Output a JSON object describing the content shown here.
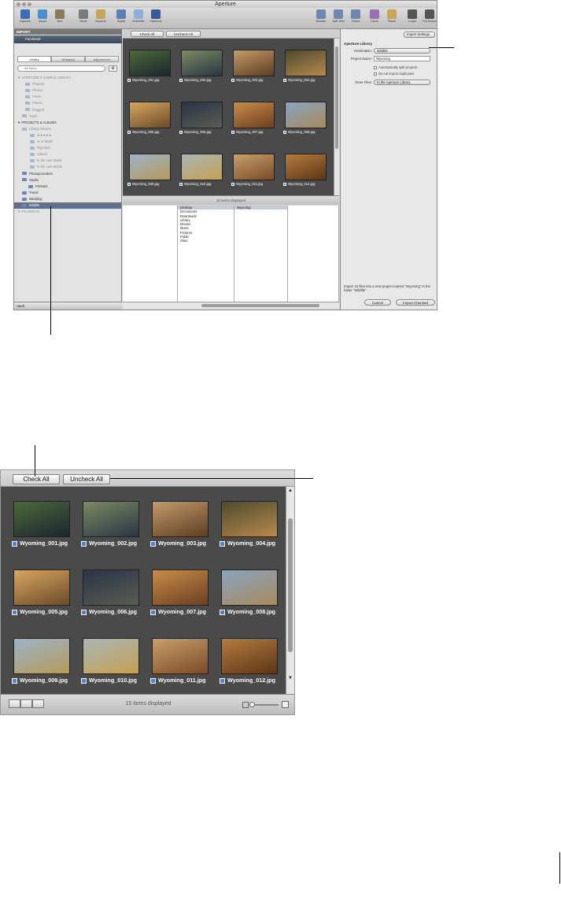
{
  "window": {
    "title": "Aperture",
    "toolbar": [
      "Inspector",
      "Import",
      "New",
      "Name",
      "Keyword",
      "Rotate",
      "MobileMe",
      "Facebook",
      "Browser",
      "Split View",
      "Viewer",
      "Faces",
      "Places",
      "Loupe",
      "Full Screen"
    ],
    "inspector_header": "IMPORT",
    "device": "Facebook"
  },
  "sidebar": {
    "tabs": [
      "Library",
      "Metadata",
      "Adjustments"
    ],
    "search_placeholder": "All Items",
    "tree": [
      {
        "label": "APERTURE 3 SAMPLE LIBRARY",
        "kind": "header",
        "dim": true
      },
      {
        "label": "Projects",
        "kind": "item",
        "dim": true
      },
      {
        "label": "Photos",
        "kind": "item",
        "dim": true
      },
      {
        "label": "Faces",
        "kind": "item",
        "dim": true
      },
      {
        "label": "Places",
        "kind": "item",
        "dim": true
      },
      {
        "label": "Flagged",
        "kind": "item",
        "dim": true
      },
      {
        "label": "Trash",
        "kind": "item",
        "dim": true
      },
      {
        "label": "PROJECTS & ALBUMS",
        "kind": "header",
        "dim": false
      },
      {
        "label": "Library Albums",
        "kind": "item",
        "dim": true
      },
      {
        "label": "★★★★★",
        "kind": "item",
        "dim": true
      },
      {
        "label": "★ or better",
        "kind": "item",
        "dim": true
      },
      {
        "label": "Rejected",
        "kind": "item",
        "dim": true
      },
      {
        "label": "Videos",
        "kind": "item",
        "dim": true
      },
      {
        "label": "In the Last Week",
        "kind": "item",
        "dim": true
      },
      {
        "label": "In the Last Month",
        "kind": "item",
        "dim": true
      },
      {
        "label": "Photojournalism",
        "kind": "item",
        "dim": false
      },
      {
        "label": "Studio",
        "kind": "item",
        "dim": false
      },
      {
        "label": "Portraits",
        "kind": "item",
        "dim": false
      },
      {
        "label": "Travel",
        "kind": "item",
        "dim": false
      },
      {
        "label": "Wedding",
        "kind": "item",
        "dim": false
      },
      {
        "label": "Wildlife",
        "kind": "item",
        "dim": false,
        "selected": true
      },
      {
        "label": "FACEBOOK",
        "kind": "header",
        "dim": true
      }
    ],
    "footer": "Vault"
  },
  "browser": {
    "check_all": "Check All",
    "uncheck_all": "Uncheck All",
    "status": "15 items displayed",
    "images": [
      {
        "name": "Wyoming_001.jpg",
        "colors": [
          "#4d6a3a",
          "#1b2530"
        ]
      },
      {
        "name": "Wyoming_002.jpg",
        "colors": [
          "#7c8a63",
          "#2a3544"
        ]
      },
      {
        "name": "Wyoming_003.jpg",
        "colors": [
          "#c59a6a",
          "#5b3e24"
        ]
      },
      {
        "name": "Wyoming_004.jpg",
        "colors": [
          "#4e4a2c",
          "#b8894f"
        ]
      },
      {
        "name": "Wyoming_005.jpg",
        "colors": [
          "#d9a660",
          "#6a4a2a"
        ]
      },
      {
        "name": "Wyoming_006.jpg",
        "colors": [
          "#2b3347",
          "#5a5d52"
        ]
      },
      {
        "name": "Wyoming_007.jpg",
        "colors": [
          "#c98c4a",
          "#6b3f22"
        ]
      },
      {
        "name": "Wyoming_008.jpg",
        "colors": [
          "#8aa3be",
          "#a88a5b"
        ]
      },
      {
        "name": "Wyoming_009.jpg",
        "colors": [
          "#9db3c7",
          "#b69a5a"
        ]
      },
      {
        "name": "Wyoming_010.jpg",
        "colors": [
          "#a9b6b4",
          "#c6a053"
        ]
      },
      {
        "name": "Wyoming_011.jpg",
        "colors": [
          "#c9a06a",
          "#7a4a28"
        ]
      },
      {
        "name": "Wyoming_012.jpg",
        "colors": [
          "#b67b3e",
          "#5b3618"
        ]
      }
    ],
    "columns": [
      [],
      [
        "Desktop",
        "Documents",
        "Downloads",
        "Library",
        "Movies",
        "Music",
        "Pictures",
        "Public",
        "Sites"
      ],
      [
        "Wyoming"
      ],
      []
    ]
  },
  "inspector": {
    "settings_menu": "Import Settings",
    "section": "Aperture Library",
    "destination_label": "Destination:",
    "destination_value": "Wildlife",
    "project_label": "Project Name:",
    "project_value": "Wyoming",
    "opt_split": "Automatically split projects",
    "opt_dupes": "Do not import duplicates",
    "store_label": "Store Files:",
    "store_value": "In the Aperture Library",
    "note": "Import 15 files into a new project named \"Wyoming\" in the folder \"Wildlife\"",
    "cancel": "Cancel",
    "import_checked": "Import Checked"
  }
}
